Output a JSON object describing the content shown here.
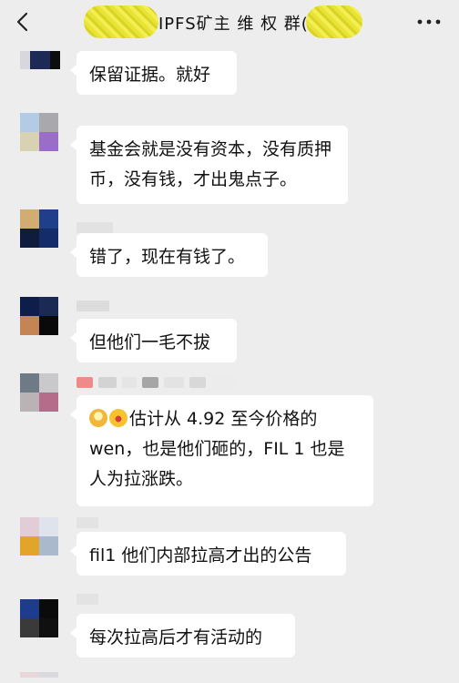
{
  "header": {
    "title": "IPFS矿主 维 权 群("
  },
  "messages": [
    {
      "text": "保留证据。就好"
    },
    {
      "text": "基金会就是没有资本，没有质押币，没有钱，才出鬼点子。"
    },
    {
      "text": "错了，现在有钱了。"
    },
    {
      "text": "但他们一毛不拔"
    },
    {
      "text": "估计从 4.92 至今价格的 wen，也是他们砸的，FIL 1 也是人为拉涨跌。"
    },
    {
      "text": "fil1 他们内部拉高才出的公告"
    },
    {
      "text": "每次拉高后才有活动的"
    }
  ],
  "icons": {
    "back": "chevron-left-icon",
    "more": "more-dots-icon",
    "scream": "scream-emoji-icon",
    "laugh": "laughing-emoji-icon"
  }
}
